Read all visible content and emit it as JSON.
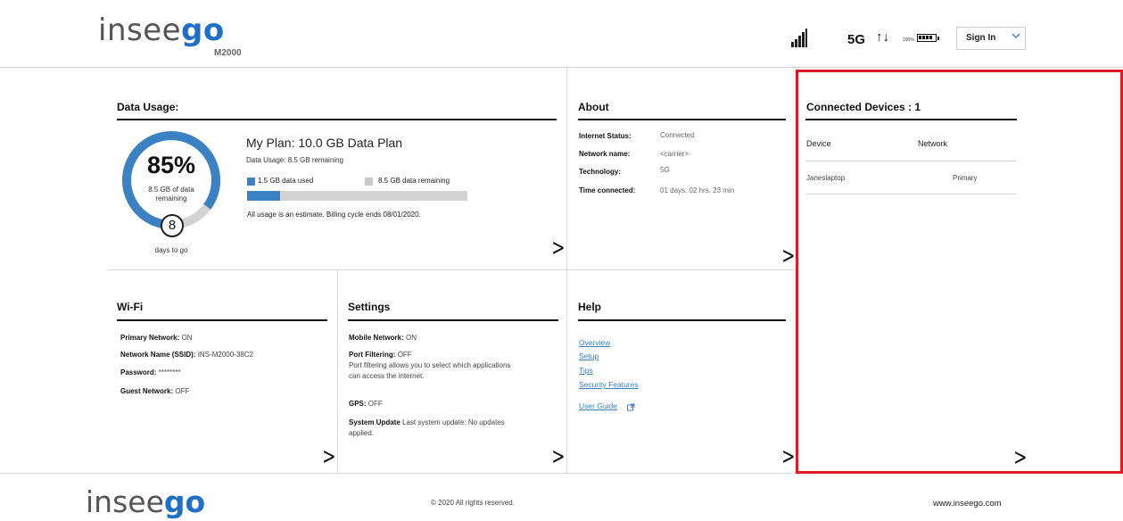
{
  "header": {
    "logo_main": "insee",
    "logo_accent": "go",
    "model": "M2000",
    "network_type": "5G",
    "transfer_arrows": "↑↓",
    "battery_percent": "100%",
    "signin_label": "Sign In",
    "signal_icon": "signal-bars-icon",
    "battery_icon": "battery-icon",
    "signal_level": 5,
    "battery_level": 1.0
  },
  "data_usage": {
    "title": "Data Usage:",
    "percent": "85%",
    "percent_value": 0.85,
    "ring_sub_line1": "8.5 GB of data",
    "ring_sub_line2": "remaining",
    "days": "8",
    "days_label": "days to go",
    "plan_title": "My Plan: 10.0 GB Data Plan",
    "plan_usage": "Data Usage: 8.5 GB remaining",
    "legend_used": "1.5 GB data used",
    "legend_remaining": "8.5 GB data remaining",
    "used_fraction": 0.15,
    "note": "All usage is an estimate. Billing cycle ends 08/01/2020.",
    "colors": {
      "accent": "#3b82c4",
      "track": "#d3d3d3"
    }
  },
  "about": {
    "title": "About",
    "rows": [
      {
        "label": "Internet Status:",
        "value": "Connected"
      },
      {
        "label": "Network name:",
        "value": "<carrier>"
      },
      {
        "label": "Technology:",
        "value": "5G"
      },
      {
        "label": "Time connected:",
        "value": "01 days, 02 hrs, 23 min"
      }
    ]
  },
  "devices": {
    "title": "Connected Devices : 1",
    "col_device": "Device",
    "col_network": "Network",
    "rows": [
      {
        "device": "Janeslaptop",
        "network": "Primary"
      }
    ],
    "highlight_color": "#e01a22"
  },
  "wifi": {
    "title": "Wi-Fi",
    "rows": [
      {
        "label": "Primary Network:",
        "value": "ON"
      },
      {
        "label": "Network Name (SSID):",
        "value": "INS-M2000-38C2"
      },
      {
        "label": "Password:",
        "value": "********"
      },
      {
        "label": "Guest Network:",
        "value": "OFF"
      }
    ]
  },
  "settings": {
    "title": "Settings",
    "mobile_label": "Mobile Network:",
    "mobile_value": "ON",
    "port_label": "Port Filtering:",
    "port_value": "OFF",
    "port_desc_1": "Port filtering allows you to select which applications",
    "port_desc_2": "can access the internet.",
    "gps_label": "GPS:",
    "gps_value": "OFF",
    "update_label": "System Update",
    "update_value_1": "Last system update: No updates",
    "update_value_2": "applied."
  },
  "help": {
    "title": "Help",
    "links": [
      "Overview",
      "Setup",
      "Tips",
      "Security Features"
    ],
    "user_guide": "User Guide",
    "external_icon": "external-link-icon"
  },
  "footer": {
    "logo_main": "insee",
    "logo_accent": "go",
    "copyright": "© 2020 All rights reserved.",
    "site": "www.inseego.com"
  }
}
